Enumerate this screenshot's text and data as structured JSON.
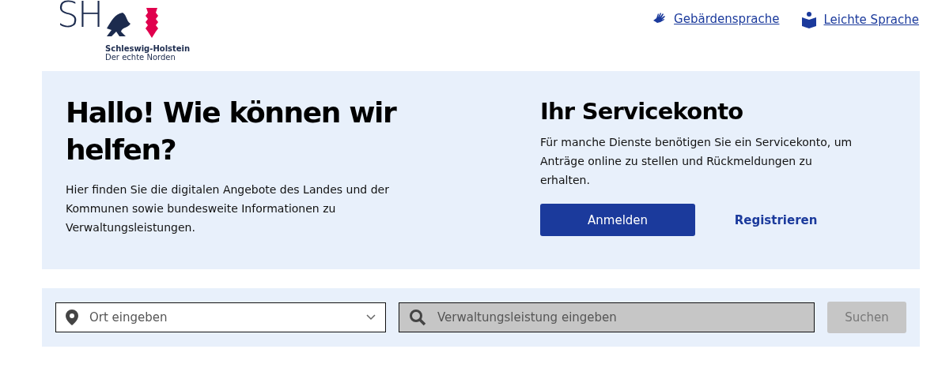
{
  "header": {
    "logo": {
      "letters": "SH",
      "name": "Schleswig-Holstein",
      "tagline": "Der echte Norden"
    },
    "links": [
      {
        "kind": "sign",
        "label": "Gebärdensprache"
      },
      {
        "kind": "easy",
        "label": "Leichte Sprache"
      }
    ]
  },
  "hero": {
    "title": "Hallo! Wie können wir helfen?",
    "text": "Hier finden Sie die digitalen Angebote des Landes und der Kommunen sowie bundesweite Informationen zu Verwaltungsleistungen."
  },
  "account": {
    "title": "Ihr Servicekonto",
    "text": "Für manche Dienste benötigen Sie ein Servicekonto, um Anträge online zu stellen und Rückmeldungen zu erhalten.",
    "login": "Anmelden",
    "register": "Registrieren"
  },
  "search": {
    "location": {
      "placeholder": "Ort eingeben"
    },
    "service": {
      "placeholder": "Verwaltungsleistung eingeben",
      "disabled": true
    },
    "button": {
      "label": "Suchen",
      "disabled": true
    }
  }
}
